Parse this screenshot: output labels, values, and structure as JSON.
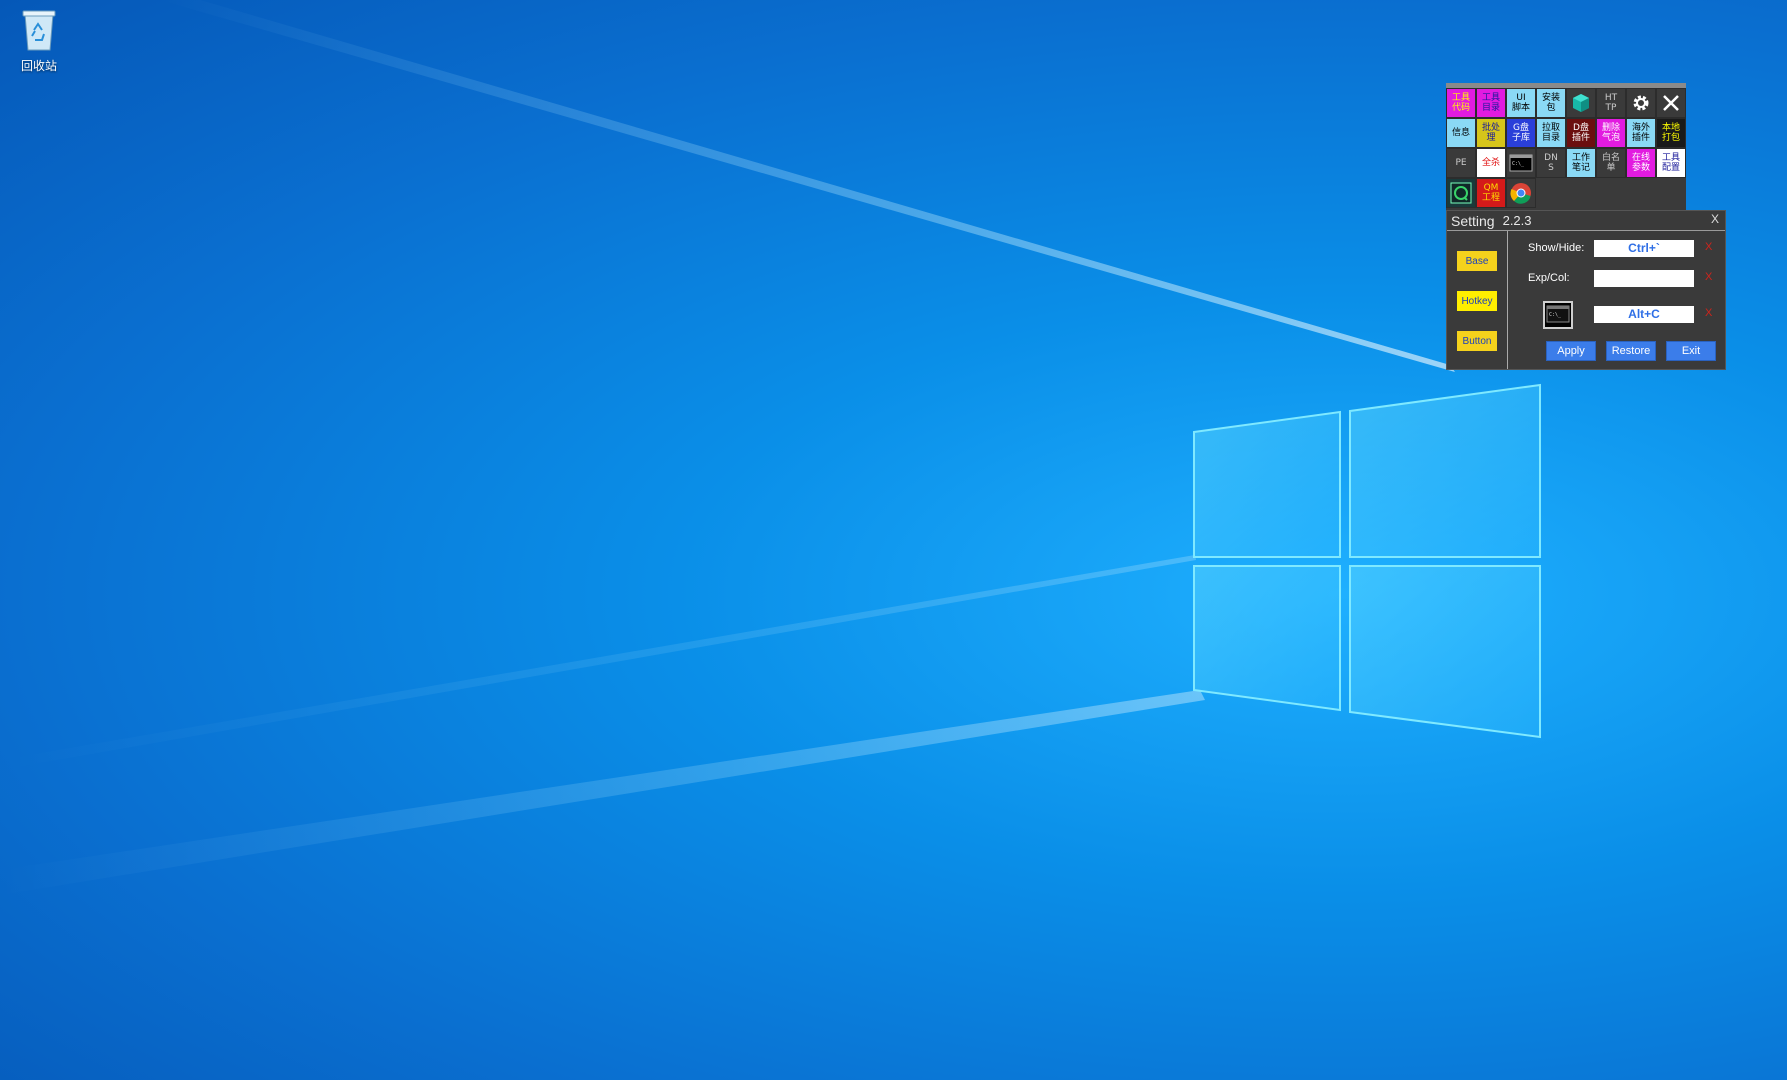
{
  "desktop": {
    "recycle_bin_label": "回收站"
  },
  "launcher": {
    "cells": [
      {
        "label": "工具\n代码",
        "bg": "#e21be0",
        "fg": "#ffff00"
      },
      {
        "label": "工具\n目录",
        "bg": "#e21be0",
        "fg": "#1a1a9a"
      },
      {
        "label": "UI\n脚本",
        "bg": "#8ad9f5",
        "fg": "#000000"
      },
      {
        "label": "安装\n包",
        "bg": "#8ad9f5",
        "fg": "#000000"
      },
      {
        "label": "",
        "icon": "cube-icon",
        "bg": "#3a3a3a",
        "fg": "#ffffff"
      },
      {
        "label": "HT\nTP",
        "bg": "#3a3a3a",
        "fg": "#cccccc"
      },
      {
        "label": "",
        "icon": "gear-icon",
        "bg": "#3a3a3a",
        "fg": "#ffffff"
      },
      {
        "label": "",
        "icon": "close-icon",
        "bg": "#3a3a3a",
        "fg": "#ffffff"
      },
      {
        "label": "信息",
        "bg": "#8ad9f5",
        "fg": "#000000"
      },
      {
        "label": "批处\n理",
        "bg": "#d6c51a",
        "fg": "#1a1a9a"
      },
      {
        "label": "G盘\n子库",
        "bg": "#2a3fd9",
        "fg": "#ffffff"
      },
      {
        "label": "拉取\n目录",
        "bg": "#8ad9f5",
        "fg": "#000000"
      },
      {
        "label": "D盘\n插件",
        "bg": "#6b0f0f",
        "fg": "#ffffff"
      },
      {
        "label": "删除\n气泡",
        "bg": "#e21be0",
        "fg": "#ffffff"
      },
      {
        "label": "海外\n插件",
        "bg": "#8ad9f5",
        "fg": "#000000"
      },
      {
        "label": "本地\n打包",
        "bg": "#1a1a1a",
        "fg": "#ffff00"
      },
      {
        "label": "PE",
        "bg": "#3a3a3a",
        "fg": "#cccccc"
      },
      {
        "label": "全杀",
        "bg": "#ffffff",
        "fg": "#e01010"
      },
      {
        "label": "",
        "icon": "terminal-icon",
        "bg": "#3a3a3a",
        "fg": "#ffffff"
      },
      {
        "label": "DN\nS",
        "bg": "#3a3a3a",
        "fg": "#cccccc"
      },
      {
        "label": "工作\n笔记",
        "bg": "#8ad9f5",
        "fg": "#000000"
      },
      {
        "label": "白名\n单",
        "bg": "#3a3a3a",
        "fg": "#cccccc"
      },
      {
        "label": "在线\n参数",
        "bg": "#e21be0",
        "fg": "#ffffff"
      },
      {
        "label": "工具\n配置",
        "bg": "#ffffff",
        "fg": "#1a1a9a"
      },
      {
        "label": "",
        "icon": "refresh-app-icon",
        "bg": "#1a3a3a",
        "fg": "#39d46a"
      },
      {
        "label": "QM\n工程",
        "bg": "#d41a1a",
        "fg": "#ffdd00"
      },
      {
        "label": "",
        "icon": "chrome-icon",
        "bg": "#3a3a3a",
        "fg": "#ffffff"
      }
    ]
  },
  "setting": {
    "title": "Setting",
    "version": "2.2.3",
    "close_label": "X",
    "nav": {
      "base": "Base",
      "hotkey": "Hotkey",
      "button": "Button"
    },
    "rows": {
      "show_hide_label": "Show/Hide:",
      "show_hide_value": "Ctrl+`",
      "exp_col_label": "Exp/Col:",
      "exp_col_value": "",
      "cmd_value": "Alt+C"
    },
    "clear_label": "X",
    "actions": {
      "apply": "Apply",
      "restore": "Restore",
      "exit": "Exit"
    }
  },
  "colors": {
    "nav_button_bg": "#f5d21c",
    "action_button_bg": "#3b7dea",
    "clear_x": "#d0241c"
  }
}
